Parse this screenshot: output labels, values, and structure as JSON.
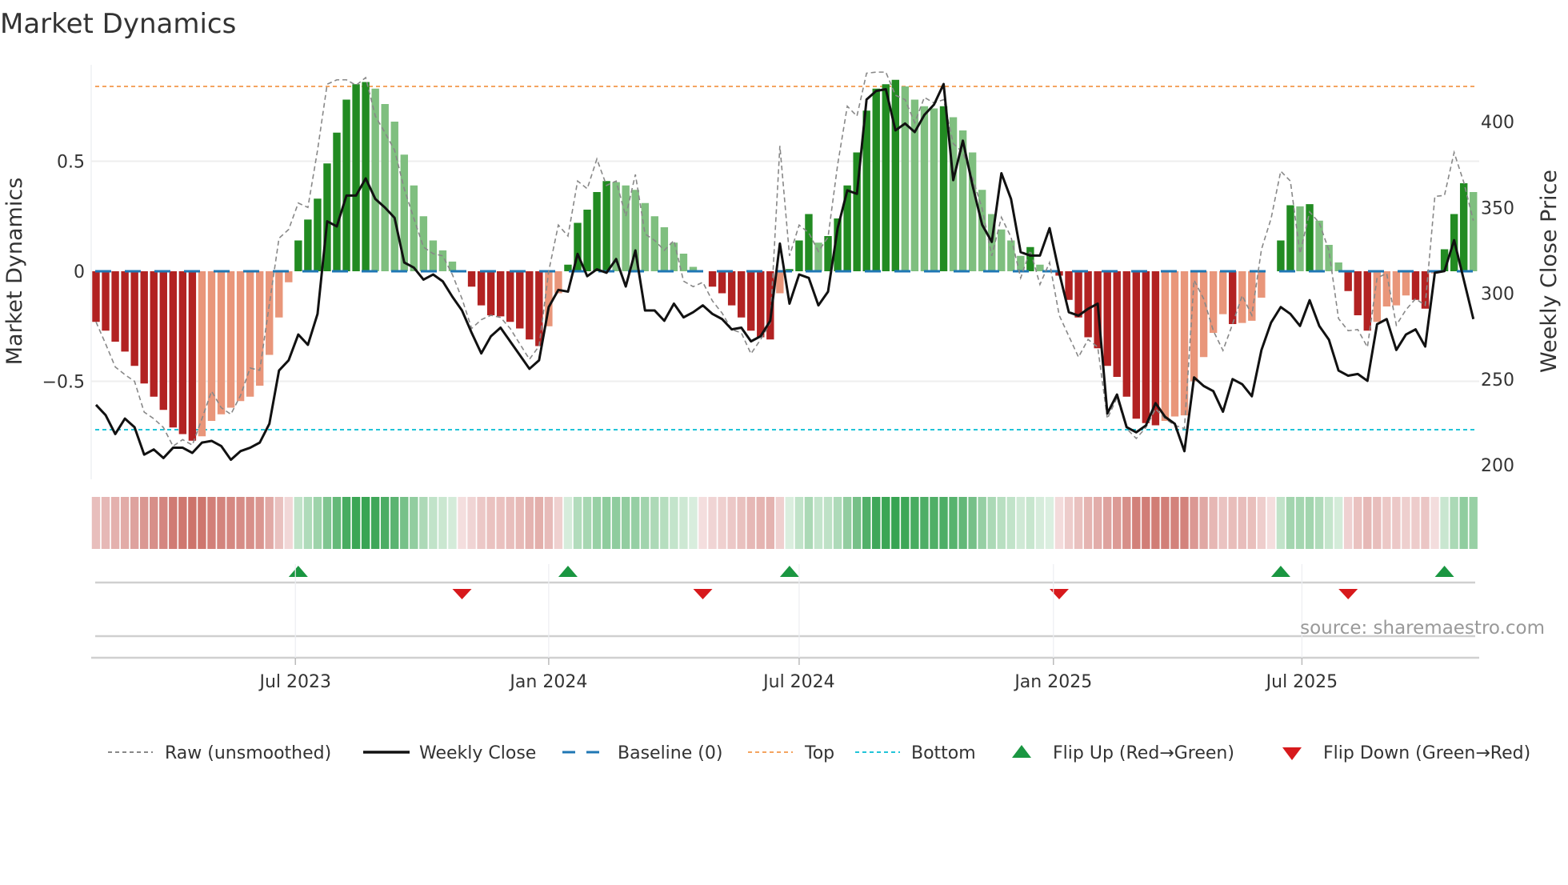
{
  "chart_data": {
    "type": "bar",
    "title": "Market Dynamics",
    "ylabel": "Market Dynamics",
    "y2label": "Weekly Close Price",
    "ylim": [
      -0.93,
      0.96
    ],
    "y2lim": [
      200,
      437
    ],
    "y_ticks": [
      {
        "value": 0.5,
        "label": "0.5"
      },
      {
        "value": 0,
        "label": "0"
      },
      {
        "value": -0.5,
        "label": "−0.5"
      }
    ],
    "y2_ticks": [
      {
        "value": 400,
        "label": "400"
      },
      {
        "value": 350,
        "label": "350"
      },
      {
        "value": 300,
        "label": "300"
      },
      {
        "value": 250,
        "label": "250"
      },
      {
        "value": 200,
        "label": "200"
      }
    ],
    "x_unit": "week index",
    "x_ticks": [
      {
        "label": "Jul 2023",
        "week": 20.7
      },
      {
        "label": "Jan 2024",
        "week": 47.0
      },
      {
        "label": "Jul 2024",
        "week": 73.0
      },
      {
        "label": "Jan 2025",
        "week": 99.4
      },
      {
        "label": "Jul 2025",
        "week": 125.2
      }
    ],
    "top_level": 0.84,
    "bottom_level": -0.72,
    "baseline": 0,
    "momentum": [
      -0.23,
      -0.27,
      -0.32,
      -0.365,
      -0.43,
      -0.51,
      -0.57,
      -0.63,
      -0.71,
      -0.74,
      -0.77,
      -0.75,
      -0.68,
      -0.65,
      -0.62,
      -0.59,
      -0.57,
      -0.52,
      -0.38,
      -0.21,
      -0.05,
      0.14,
      0.235,
      0.33,
      0.49,
      0.63,
      0.78,
      0.85,
      0.86,
      0.83,
      0.76,
      0.68,
      0.53,
      0.39,
      0.25,
      0.14,
      0.095,
      0.044,
      -0.003,
      -0.07,
      -0.155,
      -0.2,
      -0.205,
      -0.23,
      -0.26,
      -0.31,
      -0.34,
      -0.25,
      -0.1,
      0.03,
      0.22,
      0.28,
      0.36,
      0.41,
      0.405,
      0.39,
      0.37,
      0.31,
      0.25,
      0.2,
      0.13,
      0.08,
      0.02,
      -0.003,
      -0.07,
      -0.1,
      -0.155,
      -0.21,
      -0.27,
      -0.3,
      -0.31,
      -0.1,
      0.01,
      0.14,
      0.26,
      0.13,
      0.16,
      0.24,
      0.39,
      0.54,
      0.73,
      0.83,
      0.85,
      0.87,
      0.84,
      0.78,
      0.75,
      0.74,
      0.75,
      0.7,
      0.64,
      0.54,
      0.37,
      0.26,
      0.19,
      0.14,
      0.07,
      0.11,
      0.03,
      0.003,
      -0.02,
      -0.13,
      -0.21,
      -0.3,
      -0.35,
      -0.43,
      -0.48,
      -0.57,
      -0.67,
      -0.69,
      -0.7,
      -0.68,
      -0.66,
      -0.655,
      -0.5,
      -0.39,
      -0.28,
      -0.195,
      -0.24,
      -0.235,
      -0.225,
      -0.12,
      -0.003,
      0.14,
      0.3,
      0.295,
      0.305,
      0.23,
      0.12,
      0.04,
      -0.09,
      -0.2,
      -0.27,
      -0.23,
      -0.16,
      -0.155,
      -0.11,
      -0.13,
      -0.17,
      -0.01,
      0.1,
      0.26,
      0.4,
      0.36
    ],
    "raw_unsmoothed": [
      -0.23,
      -0.33,
      -0.435,
      -0.47,
      -0.5,
      -0.64,
      -0.67,
      -0.71,
      -0.795,
      -0.765,
      -0.79,
      -0.67,
      -0.545,
      -0.62,
      -0.65,
      -0.565,
      -0.44,
      -0.45,
      -0.15,
      0.15,
      0.19,
      0.31,
      0.29,
      0.55,
      0.85,
      0.87,
      0.87,
      0.845,
      0.88,
      0.705,
      0.63,
      0.55,
      0.375,
      0.24,
      0.11,
      0.08,
      0.07,
      -0.015,
      -0.125,
      -0.26,
      -0.22,
      -0.2,
      -0.21,
      -0.26,
      -0.33,
      -0.4,
      -0.34,
      0.0,
      0.21,
      0.16,
      0.41,
      0.375,
      0.51,
      0.39,
      0.41,
      0.25,
      0.44,
      0.17,
      0.14,
      0.095,
      0.14,
      -0.045,
      -0.07,
      -0.05,
      -0.135,
      -0.19,
      -0.265,
      -0.28,
      -0.375,
      -0.31,
      -0.235,
      0.57,
      0.07,
      0.21,
      0.175,
      0.09,
      0.155,
      0.485,
      0.75,
      0.705,
      0.9,
      0.905,
      0.905,
      0.8,
      0.78,
      0.675,
      0.79,
      0.765,
      0.78,
      0.58,
      0.54,
      0.425,
      0.285,
      0.07,
      0.245,
      0.155,
      -0.03,
      0.095,
      -0.06,
      0.04,
      -0.2,
      -0.295,
      -0.39,
      -0.31,
      -0.345,
      -0.67,
      -0.575,
      -0.715,
      -0.76,
      -0.71,
      -0.625,
      -0.67,
      -0.7,
      -0.715,
      -0.04,
      -0.125,
      -0.27,
      -0.36,
      -0.24,
      -0.11,
      -0.2,
      0.1,
      0.24,
      0.455,
      0.41,
      0.08,
      0.27,
      0.22,
      0.095,
      -0.215,
      -0.27,
      -0.265,
      -0.345,
      -0.03,
      -0.01,
      -0.245,
      -0.175,
      -0.125,
      -0.155,
      0.34,
      0.345,
      0.54,
      0.405,
      0.23
    ],
    "weekly_close": [
      235,
      229,
      218,
      227,
      222,
      206,
      209,
      204,
      210,
      210,
      207,
      213,
      214,
      211,
      203,
      208,
      210,
      213,
      224,
      255,
      261,
      276,
      270,
      288,
      342,
      339,
      357,
      357,
      367,
      355,
      350,
      344,
      318,
      315,
      308,
      311,
      307,
      298,
      290,
      277,
      265,
      275,
      280,
      272,
      264,
      256,
      261,
      292,
      302,
      301,
      323,
      310,
      314,
      312,
      320,
      304,
      325,
      290,
      290,
      284,
      294,
      286,
      289,
      293,
      288,
      285,
      279,
      280,
      272,
      275,
      284,
      329,
      294,
      311,
      309,
      293,
      301,
      338,
      360,
      358,
      413,
      418,
      419,
      395,
      399,
      394,
      404,
      410,
      422,
      366,
      389,
      363,
      340,
      330,
      370,
      355,
      324,
      322,
      322,
      338,
      312,
      289,
      287,
      291,
      294,
      230,
      241,
      222,
      219,
      223,
      236,
      228,
      224,
      208,
      251,
      246,
      243,
      231,
      250,
      247,
      240,
      267,
      283,
      292,
      288,
      281,
      296,
      281,
      273,
      255,
      252,
      253,
      249,
      282,
      285,
      267,
      276,
      279,
      269,
      312,
      313,
      331,
      308,
      285
    ],
    "legend": {
      "placement": "bottom",
      "raw": "Raw (unsmoothed)",
      "close": "Weekly Close",
      "baseline": "Baseline (0)",
      "top": "Top",
      "bottom": "Bottom",
      "flip_up": "Flip Up (Red→Green)",
      "flip_down": "Flip Down (Green→Red)"
    },
    "colors": {
      "strong_green": "#228b22",
      "weak_green": "#7fbf7f",
      "strong_red": "#b22222",
      "weak_red": "#e9967a",
      "baseline": "#1f77b4",
      "top": "#f4a460",
      "bottom": "#22c4d8",
      "raw": "#888888",
      "close": "#111111",
      "flip_up": "#1a9641",
      "flip_down": "#d7191c"
    },
    "source": "source: sharemaestro.com"
  }
}
